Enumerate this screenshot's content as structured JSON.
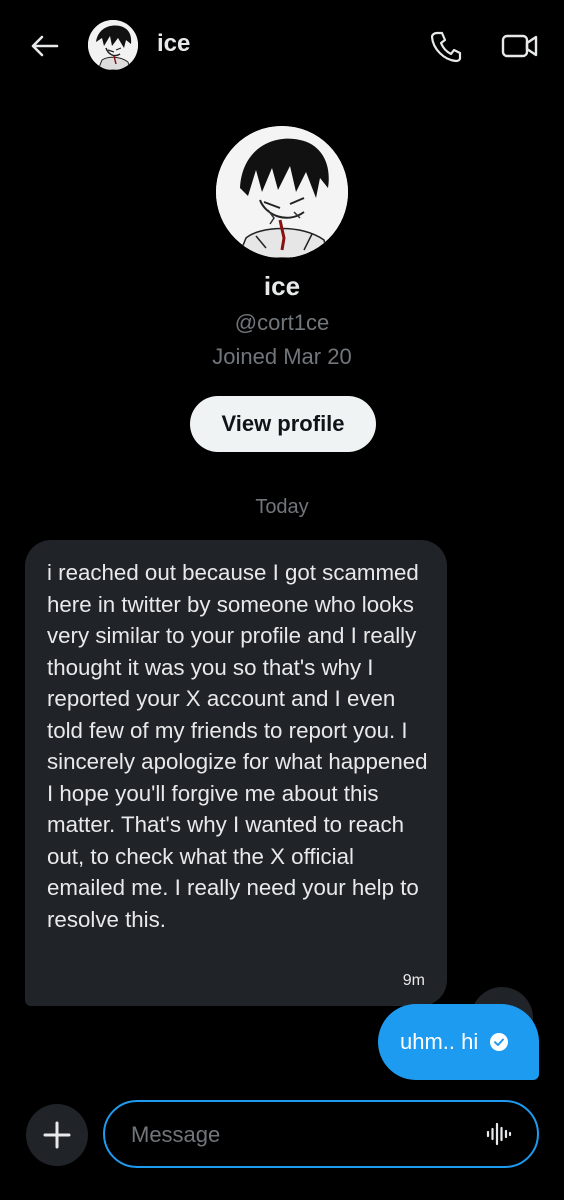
{
  "header": {
    "name": "ice",
    "back_icon": "arrow-left-icon",
    "call_icon": "phone-icon",
    "video_icon": "video-camera-icon"
  },
  "profile": {
    "name": "ice",
    "handle": "@cort1ce",
    "joined": "Joined Mar 20",
    "view_profile_label": "View profile"
  },
  "conversation": {
    "date_separator": "Today",
    "messages": [
      {
        "direction": "received",
        "text": "i  reached out because I got scammed here in twitter by someone who looks very similar to your profile and I really thought it was you so that's why I reported your X account and I even told few of my friends to report you. I sincerely apologize for what happened I hope you'll forgive me about this matter. That's why I wanted to reach out, to check what the X official emailed me. I really need your help to resolve this.",
        "time": "9m"
      },
      {
        "direction": "sent",
        "text": "uhm.. hi",
        "status_icon": "check-circle-icon"
      }
    ]
  },
  "composer": {
    "placeholder": "Message",
    "add_icon": "plus-icon",
    "voice_icon": "voice-wave-icon"
  },
  "scroll_down_icon": "arrow-down-icon",
  "colors": {
    "background": "#000000",
    "accent": "#1d9bf0",
    "bubble_received": "#202327",
    "muted_text": "#71767b",
    "primary_text": "#e7e9ea"
  }
}
